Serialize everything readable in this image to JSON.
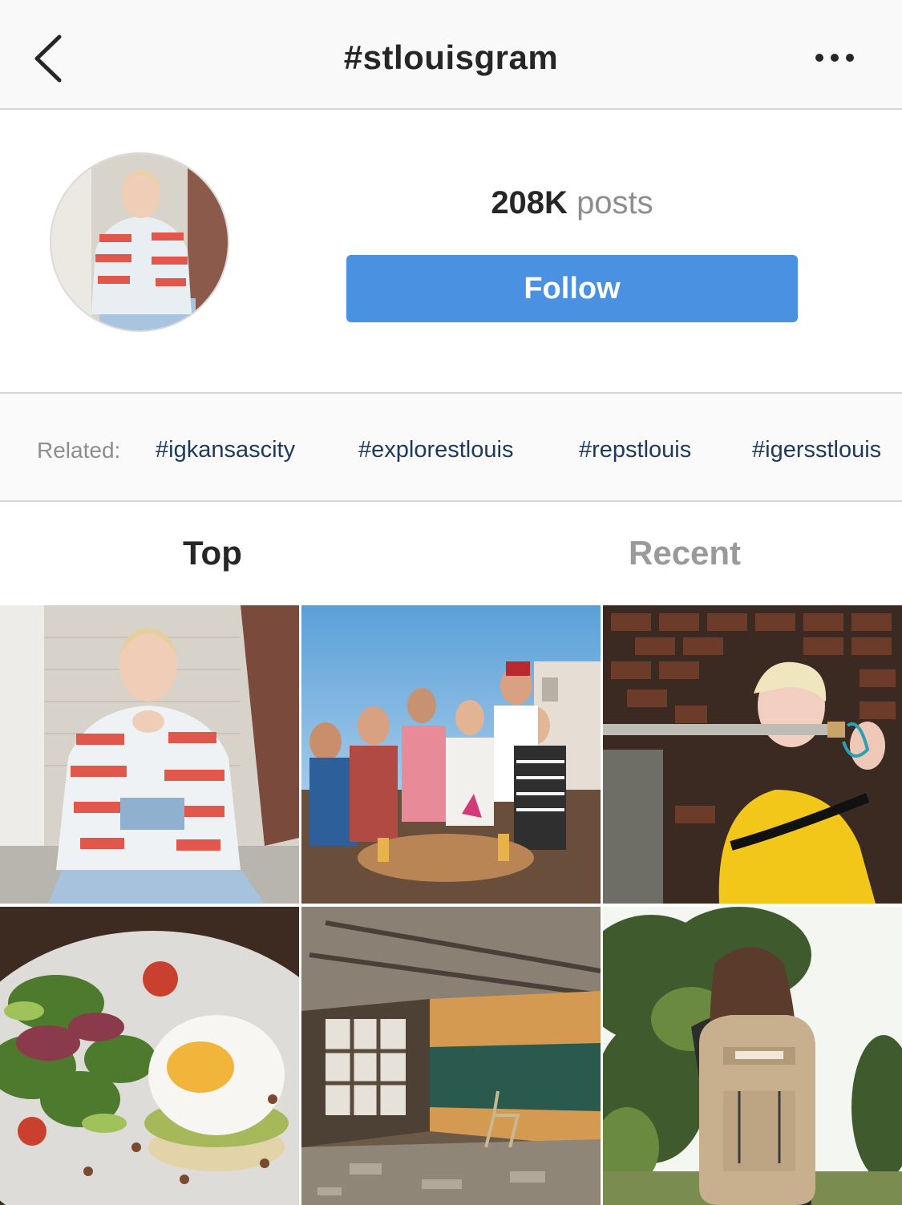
{
  "nav": {
    "title": "#stlouisgram",
    "back_icon": "chevron-left-icon",
    "more_icon": "ellipsis-icon"
  },
  "header": {
    "post_count": "208K",
    "post_label": "posts",
    "follow_label": "Follow",
    "follow_color": "#4a91e2"
  },
  "related": {
    "label": "Related:",
    "tags": [
      "#igkansascity",
      "#explorestlouis",
      "#repstlouis",
      "#igersstlouis"
    ]
  },
  "tabs": {
    "top": "Top",
    "recent": "Recent"
  },
  "grid": {
    "posts": [
      {
        "subject": "woman-red-jacket-photo"
      },
      {
        "subject": "group-rooftop-photo"
      },
      {
        "subject": "woman-sword-yellow-jacket-photo"
      },
      {
        "subject": "egg-salad-food-photo"
      },
      {
        "subject": "abandoned-classroom-photo"
      },
      {
        "subject": "woman-backpack-park-photo"
      }
    ]
  }
}
